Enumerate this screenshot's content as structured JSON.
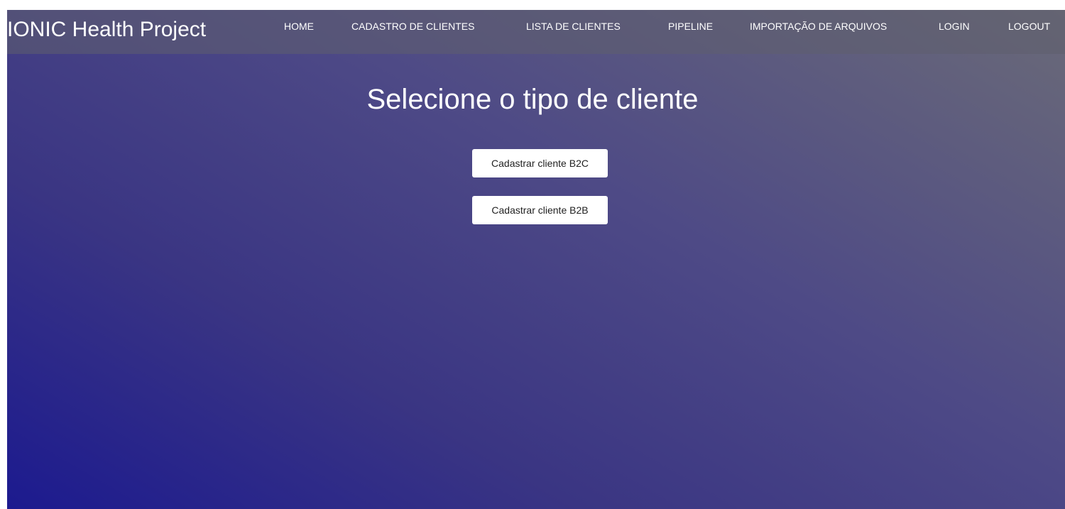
{
  "navbar": {
    "brand": "IONIC Health Project",
    "items": [
      {
        "label": "HOME"
      },
      {
        "label": "CADASTRO DE CLIENTES"
      },
      {
        "label": "LISTA DE CLIENTES"
      },
      {
        "label": "PIPELINE"
      },
      {
        "label": "IMPORTAÇÃO DE ARQUIVOS"
      },
      {
        "label": "LOGIN"
      },
      {
        "label": "LOGOUT"
      }
    ]
  },
  "main": {
    "title": "Selecione o tipo de cliente",
    "buttons": [
      {
        "label": "Cadastrar cliente B2C"
      },
      {
        "label": "Cadastrar cliente B2B"
      }
    ]
  },
  "colors": {
    "gradient_start": "#1c1a8f",
    "gradient_end": "#6a6a78",
    "button_bg": "#ffffff"
  }
}
